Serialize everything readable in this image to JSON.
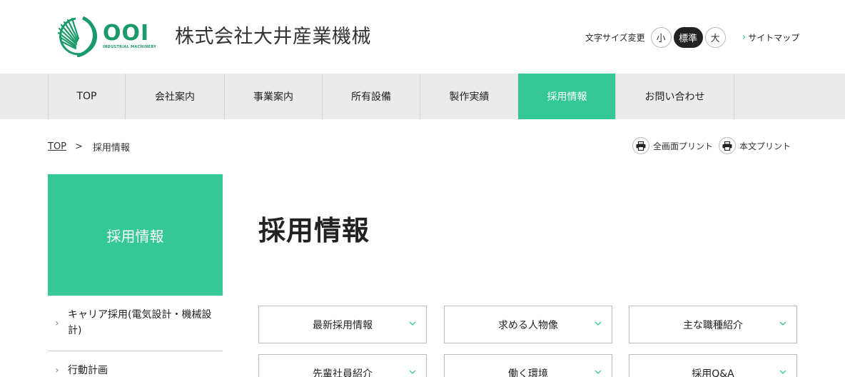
{
  "header": {
    "logo_text": "OOI",
    "logo_subtext": "INDUSTRIAL MACHINERY",
    "company_name": "株式会社大井産業機械",
    "font_size_label": "文字サイズ変更",
    "font_sizes": [
      "小",
      "標準",
      "大"
    ],
    "font_size_selected": "標準",
    "sitemap_label": "サイトマップ"
  },
  "nav": {
    "items": [
      "TOP",
      "会社案内",
      "事業案内",
      "所有設備",
      "製作実績",
      "採用情報",
      "お問い合わせ"
    ],
    "active": "採用情報"
  },
  "breadcrumb": {
    "top": "TOP",
    "separator": ">",
    "current": "採用情報"
  },
  "print": {
    "full": "全画面プリント",
    "body": "本文プリント"
  },
  "sidebar": {
    "title": "採用情報",
    "items": [
      {
        "label": "キャリア採用(電気設計・機械設計)"
      },
      {
        "label": "行動計画"
      }
    ]
  },
  "main": {
    "title": "採用情報",
    "anchors": [
      "最新採用情報",
      "求める人物像",
      "主な職種紹介",
      "先輩社員紹介",
      "働く環境",
      "採用Q&A"
    ]
  },
  "colors": {
    "accent": "#33c895",
    "logo_green": "#1a9a6a",
    "nav_bg": "#ebebeb"
  }
}
